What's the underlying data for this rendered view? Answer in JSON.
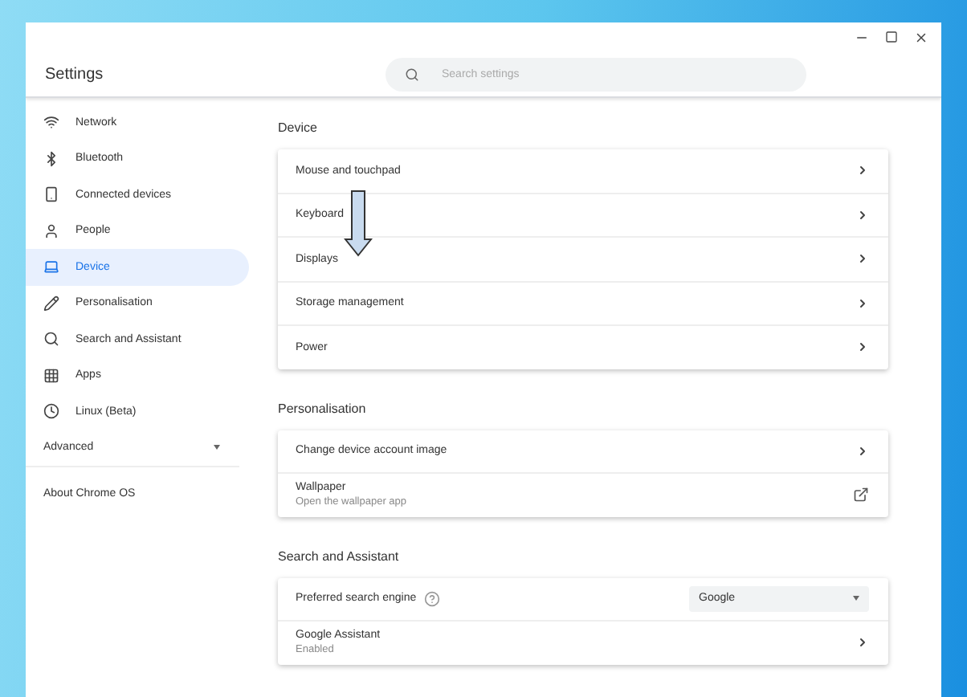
{
  "window": {
    "title": "Settings"
  },
  "search": {
    "placeholder": "Search settings"
  },
  "sidebar": {
    "items": [
      {
        "label": "Network",
        "selected": false
      },
      {
        "label": "Bluetooth",
        "selected": false
      },
      {
        "label": "Connected devices",
        "selected": false
      },
      {
        "label": "People",
        "selected": false
      },
      {
        "label": "Device",
        "selected": true
      },
      {
        "label": "Personalisation",
        "selected": false
      },
      {
        "label": "Search and Assistant",
        "selected": false
      },
      {
        "label": "Apps",
        "selected": false
      },
      {
        "label": "Linux (Beta)",
        "selected": false
      }
    ],
    "advanced": {
      "label": "Advanced",
      "expanded": false
    },
    "about": "About Chrome OS"
  },
  "sections": [
    {
      "title": "Device",
      "rows": [
        {
          "kind": "link",
          "label": "Mouse and touchpad"
        },
        {
          "kind": "link",
          "label": "Keyboard"
        },
        {
          "kind": "link",
          "label": "Displays"
        },
        {
          "kind": "link",
          "label": "Storage management"
        },
        {
          "kind": "link",
          "label": "Power"
        }
      ]
    },
    {
      "title": "Personalisation",
      "rows": [
        {
          "kind": "link",
          "label": "Change device account image"
        },
        {
          "kind": "external",
          "label": "Wallpaper",
          "subtitle": "Open the wallpaper app"
        }
      ]
    },
    {
      "title": "Search and Assistant",
      "rows": [
        {
          "kind": "select",
          "label": "Preferred search engine",
          "value": "Google"
        },
        {
          "kind": "link",
          "label": "Google Assistant",
          "subtitle": "Enabled"
        }
      ]
    }
  ]
}
